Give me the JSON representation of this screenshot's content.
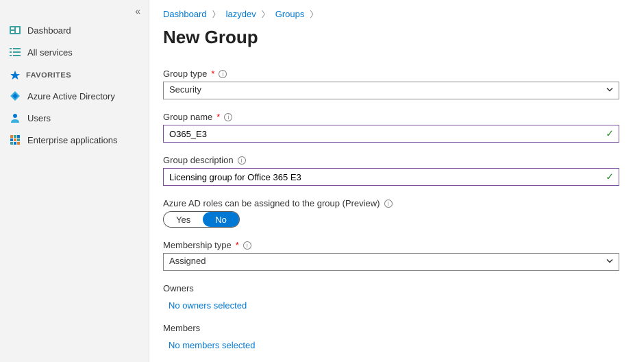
{
  "sidebar": {
    "collapse_glyph": "«",
    "items": [
      {
        "label": "Dashboard",
        "icon": "dashboard-icon"
      },
      {
        "label": "All services",
        "icon": "list-icon"
      }
    ],
    "favorites_header": "FAVORITES",
    "favorites": [
      {
        "label": "Azure Active Directory",
        "icon": "aad-icon"
      },
      {
        "label": "Users",
        "icon": "users-icon"
      },
      {
        "label": "Enterprise applications",
        "icon": "apps-icon"
      }
    ]
  },
  "breadcrumb": {
    "items": [
      "Dashboard",
      "lazydev",
      "Groups"
    ]
  },
  "page_title": "New Group",
  "form": {
    "group_type": {
      "label": "Group type",
      "required": "*",
      "value": "Security"
    },
    "group_name": {
      "label": "Group name",
      "required": "*",
      "value": "O365_E3"
    },
    "group_description": {
      "label": "Group description",
      "value": "Licensing group for Office 365 E3"
    },
    "ad_roles": {
      "label": "Azure AD roles can be assigned to the group (Preview)",
      "yes": "Yes",
      "no": "No",
      "selected": "No"
    },
    "membership_type": {
      "label": "Membership type",
      "required": "*",
      "value": "Assigned"
    },
    "owners": {
      "label": "Owners",
      "link": "No owners selected"
    },
    "members": {
      "label": "Members",
      "link": "No members selected"
    }
  }
}
